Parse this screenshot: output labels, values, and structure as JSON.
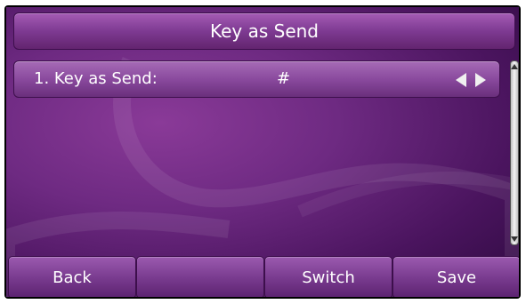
{
  "header": {
    "title": "Key as Send"
  },
  "menu": {
    "items": [
      {
        "label": "1. Key as Send:",
        "value": "#"
      }
    ]
  },
  "softkeys": [
    {
      "label": "Back"
    },
    {
      "label": ""
    },
    {
      "label": "Switch"
    },
    {
      "label": "Save"
    }
  ],
  "icons": {
    "left_arrow": "arrow-left-icon",
    "right_arrow": "arrow-right-icon",
    "scroll_up": "scroll-up-icon",
    "scroll_down": "scroll-down-icon"
  },
  "colors": {
    "accent": "#7e3a92",
    "text": "#ffffff"
  }
}
